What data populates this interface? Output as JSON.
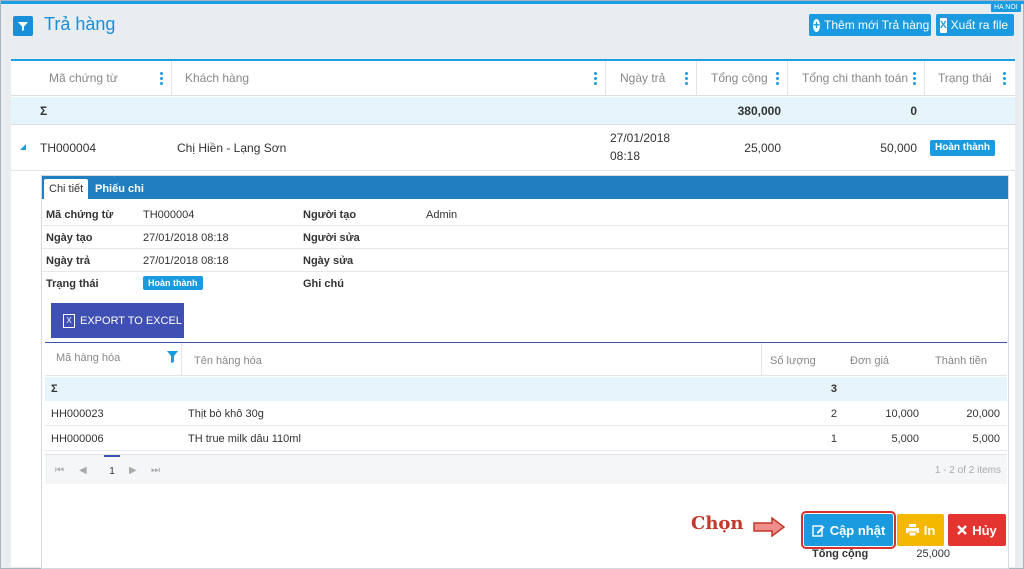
{
  "header": {
    "title": "Trả hàng",
    "add_label": "Thêm mới Trả hàng",
    "export_label": "Xuất ra file",
    "region": "HA NOI"
  },
  "grid": {
    "columns": [
      "Mã chứng từ",
      "Khách hàng",
      "Ngày trả",
      "Tổng cộng",
      "Tổng chi thanh toán",
      "Trạng thái"
    ],
    "sum_symbol": "Σ",
    "sum_total": "380,000",
    "sum_paid": "0",
    "row": {
      "code": "TH000004",
      "customer": "Chị Hiền - Lạng Sơn",
      "date": "27/01/2018",
      "time": "08:18",
      "total": "25,000",
      "paid": "50,000",
      "status": "Hoàn thành"
    }
  },
  "detail": {
    "tabs": [
      "Chi tiết",
      "Phiếu chi"
    ],
    "fields": {
      "code_label": "Mã chứng từ",
      "code": "TH000004",
      "creator_label": "Người tạo",
      "creator": "Admin",
      "created_label": "Ngày tạo",
      "created": "27/01/2018 08:18",
      "editor_label": "Người sửa",
      "return_label": "Ngày trả",
      "return_date": "27/01/2018 08:18",
      "edited_label": "Ngày sửa",
      "status_label": "Trạng thái",
      "status": "Hoàn thành",
      "note_label": "Ghi chú"
    },
    "export_excel": "EXPORT TO EXCEL",
    "items_columns": [
      "Mã hàng hóa",
      "Tên hàng hóa",
      "Số lượng",
      "Đơn giá",
      "Thành tiền"
    ],
    "items_sum_symbol": "Σ",
    "items_sum_qty": "3",
    "items": [
      {
        "code": "HH000023",
        "name": "Thịt bò khô 30g",
        "qty": "2",
        "price": "10,000",
        "amount": "20,000"
      },
      {
        "code": "HH000006",
        "name": "TH true milk dâu 110ml",
        "qty": "1",
        "price": "5,000",
        "amount": "5,000"
      }
    ],
    "pager": {
      "page": "1",
      "summary": "1 - 2 of 2 items"
    },
    "total_label": "Tổng cộng",
    "total_value": "25,000"
  },
  "actions": {
    "annotation": "Chọn",
    "update": "Cập nhật",
    "print": "In",
    "cancel": "Hủy"
  },
  "colors": {
    "accent": "#1a9be0",
    "warning": "#f5b800",
    "danger": "#e3342f",
    "excel": "#3f4fb4"
  }
}
